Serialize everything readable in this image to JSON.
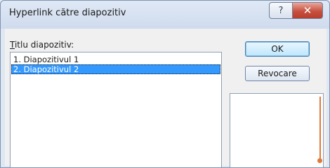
{
  "window": {
    "title": "Hyperlink către diapozitiv"
  },
  "titlebar": {
    "help_glyph": "?",
    "close_glyph": "✕"
  },
  "list": {
    "label_accel": "T",
    "label_rest": "itlu diapozitiv:",
    "items": [
      {
        "label": "1. Diapozitivul 1",
        "selected": false
      },
      {
        "label": "2. Diapozitivul 2",
        "selected": true
      }
    ]
  },
  "buttons": {
    "ok_label": "OK",
    "cancel_label": "Revocare"
  },
  "colors": {
    "selection": "#3399ff",
    "preview_accent": "#e07a3a",
    "close_red": "#c7503f"
  }
}
